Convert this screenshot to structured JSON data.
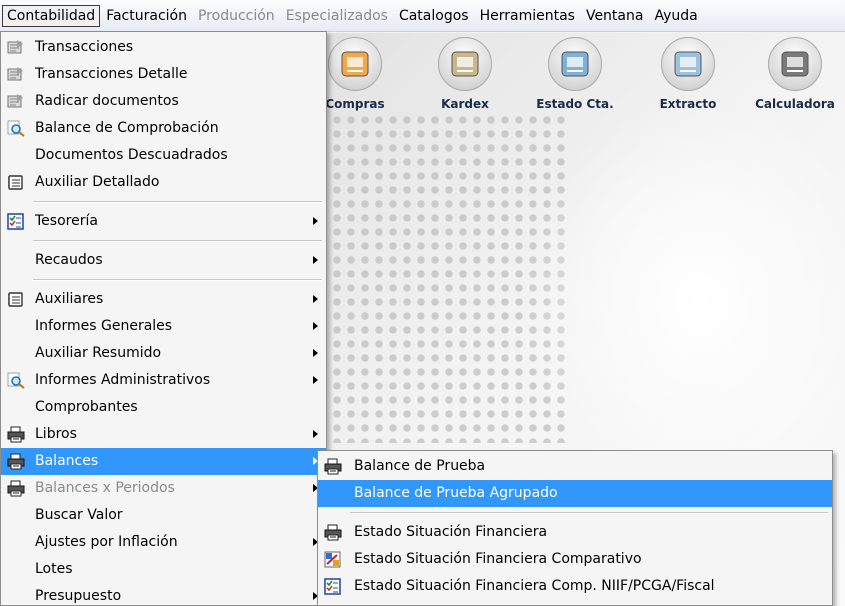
{
  "menubar": {
    "items": [
      {
        "label": "Contabilidad",
        "state": "active"
      },
      {
        "label": "Facturación",
        "state": "normal"
      },
      {
        "label": "Producción",
        "state": "disabled"
      },
      {
        "label": "Especializados",
        "state": "disabled"
      },
      {
        "label": "Catalogos",
        "state": "normal"
      },
      {
        "label": "Herramientas",
        "state": "normal"
      },
      {
        "label": "Ventana",
        "state": "normal"
      },
      {
        "label": "Ayuda",
        "state": "normal"
      }
    ]
  },
  "toolbar": {
    "buttons": [
      {
        "label": "Compras",
        "icon": "truck-icon",
        "color": "#f0a84b"
      },
      {
        "label": "Kardex",
        "icon": "clipboard-add-icon",
        "color": "#c9b78a"
      },
      {
        "label": "Estado Cta.",
        "icon": "id-card-icon",
        "color": "#7fb0d8"
      },
      {
        "label": "Extracto",
        "icon": "document-arrow-icon",
        "color": "#9cc0e0"
      },
      {
        "label": "Calculadora",
        "icon": "calculator-icon",
        "color": "#7a7a7a"
      }
    ]
  },
  "main_menu": {
    "items": [
      {
        "label": "Transacciones",
        "icon": "transactions-icon",
        "submenu": false,
        "state": "normal"
      },
      {
        "label": "Transacciones Detalle",
        "icon": "transactions-icon",
        "submenu": false,
        "state": "normal"
      },
      {
        "label": "Radicar documentos",
        "icon": "transactions-icon",
        "submenu": false,
        "state": "normal"
      },
      {
        "label": "Balance de Comprobación",
        "icon": "magnifier-icon",
        "submenu": false,
        "state": "normal"
      },
      {
        "label": "Documentos Descuadrados",
        "icon": "",
        "submenu": false,
        "state": "normal"
      },
      {
        "label": "Auxiliar Detallado",
        "icon": "ledger-icon",
        "submenu": false,
        "state": "normal"
      },
      {
        "separator": true
      },
      {
        "label": "Tesorería",
        "icon": "checklist-icon",
        "submenu": true,
        "state": "normal"
      },
      {
        "separator": true
      },
      {
        "label": "Recaudos",
        "icon": "",
        "submenu": true,
        "state": "normal"
      },
      {
        "separator": true
      },
      {
        "label": "Auxiliares",
        "icon": "ledger-icon",
        "submenu": true,
        "state": "normal"
      },
      {
        "label": "Informes Generales",
        "icon": "",
        "submenu": true,
        "state": "normal"
      },
      {
        "label": "Auxiliar Resumido",
        "icon": "",
        "submenu": true,
        "state": "normal"
      },
      {
        "label": "Informes Administrativos",
        "icon": "magnifier-icon",
        "submenu": true,
        "state": "normal"
      },
      {
        "label": "Comprobantes",
        "icon": "",
        "submenu": false,
        "state": "normal"
      },
      {
        "label": "Libros",
        "icon": "printer-icon",
        "submenu": true,
        "state": "normal"
      },
      {
        "label": "Balances",
        "icon": "printer-icon",
        "submenu": true,
        "state": "highlighted"
      },
      {
        "label": "Balances x Periodos",
        "icon": "printer-icon",
        "submenu": true,
        "state": "disabled"
      },
      {
        "label": "Buscar Valor",
        "icon": "",
        "submenu": false,
        "state": "normal"
      },
      {
        "label": "Ajustes por Inflación",
        "icon": "",
        "submenu": true,
        "state": "normal"
      },
      {
        "label": "Lotes",
        "icon": "",
        "submenu": false,
        "state": "normal"
      },
      {
        "label": "Presupuesto",
        "icon": "",
        "submenu": true,
        "state": "normal"
      }
    ]
  },
  "sub_menu": {
    "items": [
      {
        "label": "Balance de Prueba",
        "icon": "printer-icon",
        "state": "normal"
      },
      {
        "label": "Balance de Prueba Agrupado",
        "icon": "",
        "state": "highlighted"
      },
      {
        "separator": true
      },
      {
        "label": "Estado Situación Financiera",
        "icon": "printer-icon",
        "state": "normal"
      },
      {
        "label": "Estado Situación Financiera Comparativo",
        "icon": "comparative-icon",
        "state": "normal"
      },
      {
        "label": "Estado Situación Financiera Comp. NIIF/PCGA/Fiscal",
        "icon": "checklist-icon",
        "state": "normal"
      }
    ]
  },
  "colors": {
    "highlight": "#3297fd",
    "menu_bg": "#f5f5f5",
    "disabled_text": "#8a8a8a",
    "toolbar_label": "#1a2b4a"
  }
}
